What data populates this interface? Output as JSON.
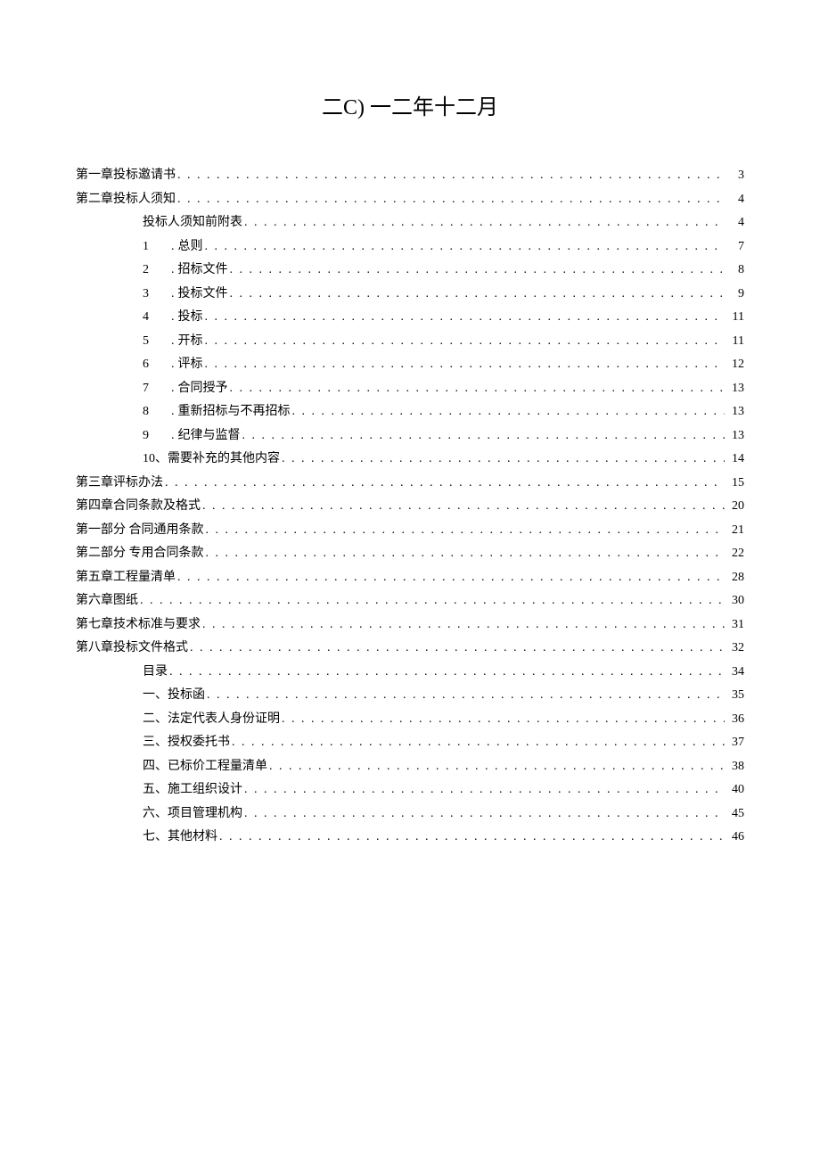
{
  "title": "二C) 一二年十二月",
  "toc": [
    {
      "level": 0,
      "label": "第一章投标邀请书",
      "page": "3"
    },
    {
      "level": 0,
      "label": "第二章投标人须知",
      "page": "4"
    },
    {
      "level": 1,
      "label": "投标人须知前附表",
      "page": "4"
    },
    {
      "level": 2,
      "num": "1",
      "sep": ".",
      "label": "总则",
      "page": "7"
    },
    {
      "level": 2,
      "num": "2",
      "sep": ".",
      "label": "招标文件",
      "page": "8"
    },
    {
      "level": 2,
      "num": "3",
      "sep": ".",
      "label": "投标文件",
      "page": "9"
    },
    {
      "level": 2,
      "num": "4",
      "sep": ".",
      "label": "投标",
      "page": "11"
    },
    {
      "level": 2,
      "num": "5",
      "sep": ".",
      "label": "开标",
      "page": "11"
    },
    {
      "level": 2,
      "num": "6",
      "sep": ".",
      "label": "评标",
      "page": "12"
    },
    {
      "level": 2,
      "num": "7",
      "sep": ".",
      "label": "合同授予",
      "page": "13"
    },
    {
      "level": 2,
      "num": "8",
      "sep": ".",
      "label": "重新招标与不再招标",
      "page": "13"
    },
    {
      "level": 2,
      "num": "9",
      "sep": ".",
      "label": "纪律与监督",
      "page": "13"
    },
    {
      "level": 1,
      "label": "10、需要补充的其他内容",
      "page": "14"
    },
    {
      "level": 0,
      "label": "第三章评标办法",
      "page": "15"
    },
    {
      "level": 0,
      "label": "第四章合同条款及格式",
      "page": "20"
    },
    {
      "level": 0,
      "label": "第一部分  合同通用条款",
      "page": "21"
    },
    {
      "level": 0,
      "label": "第二部分  专用合同条款",
      "page": "22"
    },
    {
      "level": 0,
      "label": "第五章工程量清单",
      "page": "28"
    },
    {
      "level": 0,
      "label": "第六章图纸",
      "page": "30"
    },
    {
      "level": 0,
      "label": "第七章技术标准与要求",
      "page": "31"
    },
    {
      "level": 0,
      "label": "第八章投标文件格式",
      "page": "32"
    },
    {
      "level": 1,
      "label": "目录",
      "page": "34"
    },
    {
      "level": 1,
      "label": "一、投标函",
      "page": "35"
    },
    {
      "level": 1,
      "label": "二、法定代表人身份证明",
      "page": "36"
    },
    {
      "level": 1,
      "label": "三、授权委托书",
      "page": "37"
    },
    {
      "level": 1,
      "label": "四、已标价工程量清单",
      "page": "38"
    },
    {
      "level": 1,
      "label": "五、施工组织设计",
      "page": "40"
    },
    {
      "level": 1,
      "label": "六、项目管理机构",
      "page": "45"
    },
    {
      "level": 1,
      "label": "七、其他材料",
      "page": "46"
    }
  ]
}
